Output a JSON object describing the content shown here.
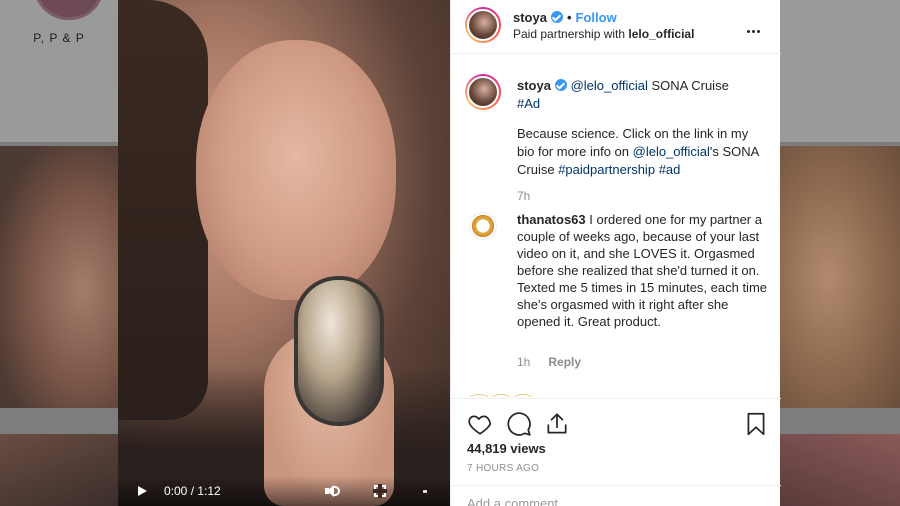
{
  "background": {
    "profile_name": "P, P & P"
  },
  "video": {
    "time": "0:00 / 1:12"
  },
  "post": {
    "header": {
      "username": "stoya",
      "follow_label": "Follow",
      "partnership_prefix": "Paid partnership with",
      "partner": "lelo_official"
    },
    "caption": {
      "username": "stoya",
      "mention": "@lelo_official",
      "product": "SONA Cruise",
      "hashtag": "#Ad",
      "body_text": "Because science. Click on the link in my bio for more info on",
      "body_mention": "@lelo_official",
      "body_suffix": "'s SONA Cruise",
      "body_tag1": "#paidpartnership",
      "body_tag2": "#ad",
      "time": "7h"
    },
    "comment": {
      "username": "thanatos63",
      "text": "I ordered one for my partner a couple of weeks ago, because of your last video on it, and she LOVES it. Orgasmed before she realized that she'd turned it on. Texted me 5 times in 15 minutes, each time she's orgasmed with it right after she opened it. Great product.",
      "time": "1h",
      "reply_label": "Reply"
    },
    "views": "44,819 views",
    "posted_ago": "7 HOURS AGO",
    "add_comment_placeholder": "Add a comment..."
  },
  "icons": [
    "play-icon",
    "volume-icon",
    "fullscreen-icon",
    "more-vertical-icon",
    "verified-icon",
    "more-horizontal-icon",
    "heart-icon",
    "comment-icon",
    "share-icon",
    "bookmark-icon"
  ],
  "colors": {
    "link_blue": "#3897f0",
    "hashtag_blue": "#003569",
    "text": "#262626",
    "muted": "#8e8e8e"
  }
}
